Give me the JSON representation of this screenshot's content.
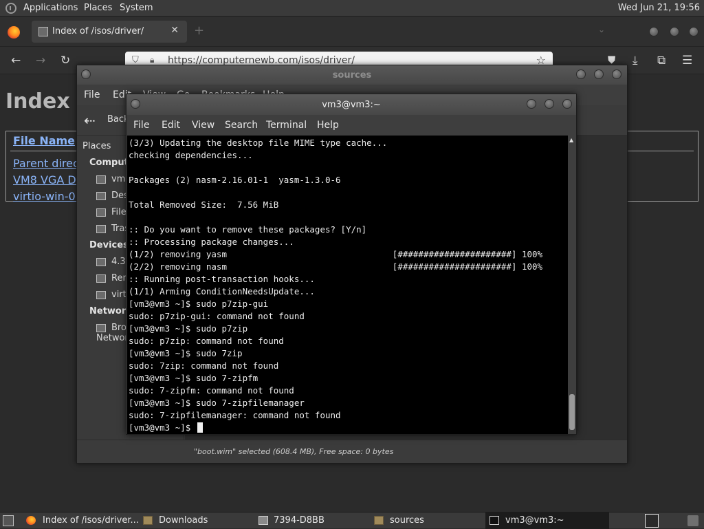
{
  "top_panel": {
    "menus": [
      "Applications",
      "Places",
      "System"
    ],
    "clock": "Wed Jun 21, 19:56"
  },
  "firefox": {
    "tab_title": "Index of /isos/driver/",
    "tab_close": "✕",
    "new_tab": "+",
    "url": "https://computernewb.com/isos/driver/",
    "page": {
      "heading": "Index of /isos/driver/",
      "table_header": "File Name",
      "rows": [
        "Parent directory/",
        "VM8 VGA Driver",
        "virtio-win-0.1"
      ]
    }
  },
  "file_manager": {
    "title": "sources",
    "menus": [
      "File",
      "Edit",
      "View",
      "Go",
      "Bookmarks",
      "Help"
    ],
    "back_label": "Back",
    "places_label": "Places",
    "sidebar": {
      "computer_heading": "Computer",
      "computer_items": [
        "vm3",
        "Desktop",
        "File System",
        "Trash"
      ],
      "devices_heading": "Devices",
      "device_items": [
        "4.3 GB Volume",
        "Removable",
        "virtio"
      ],
      "network_heading": "Network",
      "network_items": [
        "Browse Network"
      ]
    },
    "status": "\"boot.wim\" selected (608.4 MB), Free space: 0 bytes"
  },
  "terminal": {
    "title": "vm3@vm3:~",
    "menus": [
      "File",
      "Edit",
      "View",
      "Search",
      "Terminal",
      "Help"
    ],
    "lines": [
      "(3/3) Updating the desktop file MIME type cache...",
      "checking dependencies...",
      "",
      "Packages (2) nasm-2.16.01-1  yasm-1.3.0-6",
      "",
      "Total Removed Size:  7.56 MiB",
      "",
      ":: Do you want to remove these packages? [Y/n]",
      ":: Processing package changes...",
      "(1/2) removing yasm                                [######################] 100%",
      "(2/2) removing nasm                                [######################] 100%",
      ":: Running post-transaction hooks...",
      "(1/1) Arming ConditionNeedsUpdate...",
      "[vm3@vm3 ~]$ sudo p7zip-gui",
      "sudo: p7zip-gui: command not found",
      "[vm3@vm3 ~]$ sudo p7zip",
      "sudo: p7zip: command not found",
      "[vm3@vm3 ~]$ sudo 7zip",
      "sudo: 7zip: command not found",
      "[vm3@vm3 ~]$ sudo 7-zipfm",
      "sudo: 7-zipfm: command not found",
      "[vm3@vm3 ~]$ sudo 7-zipfilemanager",
      "sudo: 7-zipfilemanager: command not found"
    ],
    "prompt": "[vm3@vm3 ~]$ "
  },
  "taskbar": {
    "items": [
      "Index of /isos/driver...",
      "Downloads",
      "7394-D8BB",
      "sources",
      "vm3@vm3:~"
    ]
  }
}
